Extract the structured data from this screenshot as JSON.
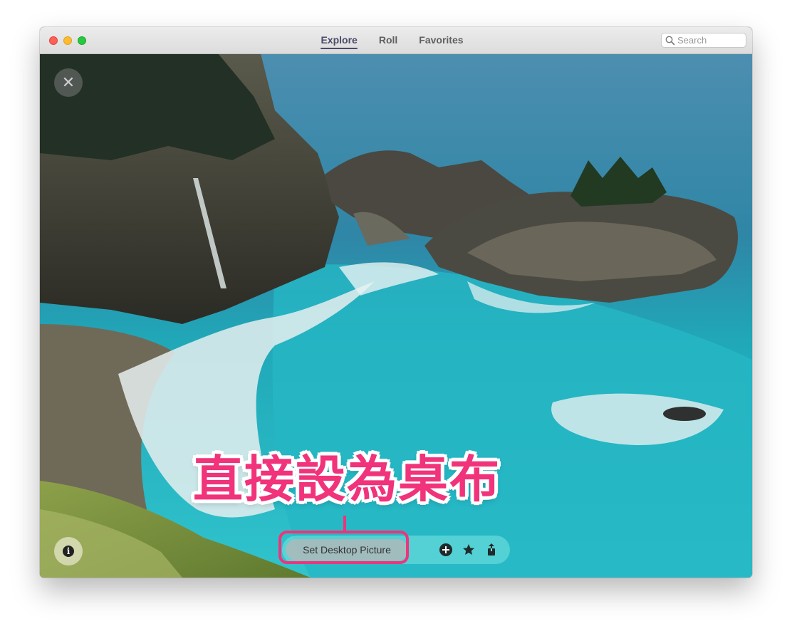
{
  "window": {
    "tabs": [
      {
        "label": "Explore",
        "active": true
      },
      {
        "label": "Roll",
        "active": false
      },
      {
        "label": "Favorites",
        "active": false
      }
    ],
    "search": {
      "placeholder": "Search",
      "value": ""
    }
  },
  "photo": {
    "close_symbol": "✕",
    "info_symbol": "i"
  },
  "action_bar": {
    "set_desktop_label": "Set Desktop Picture",
    "icons": [
      "add-circle-icon",
      "star-icon",
      "share-icon"
    ]
  },
  "annotation": {
    "text": "直接設為桌布",
    "color": "#f0337a"
  }
}
